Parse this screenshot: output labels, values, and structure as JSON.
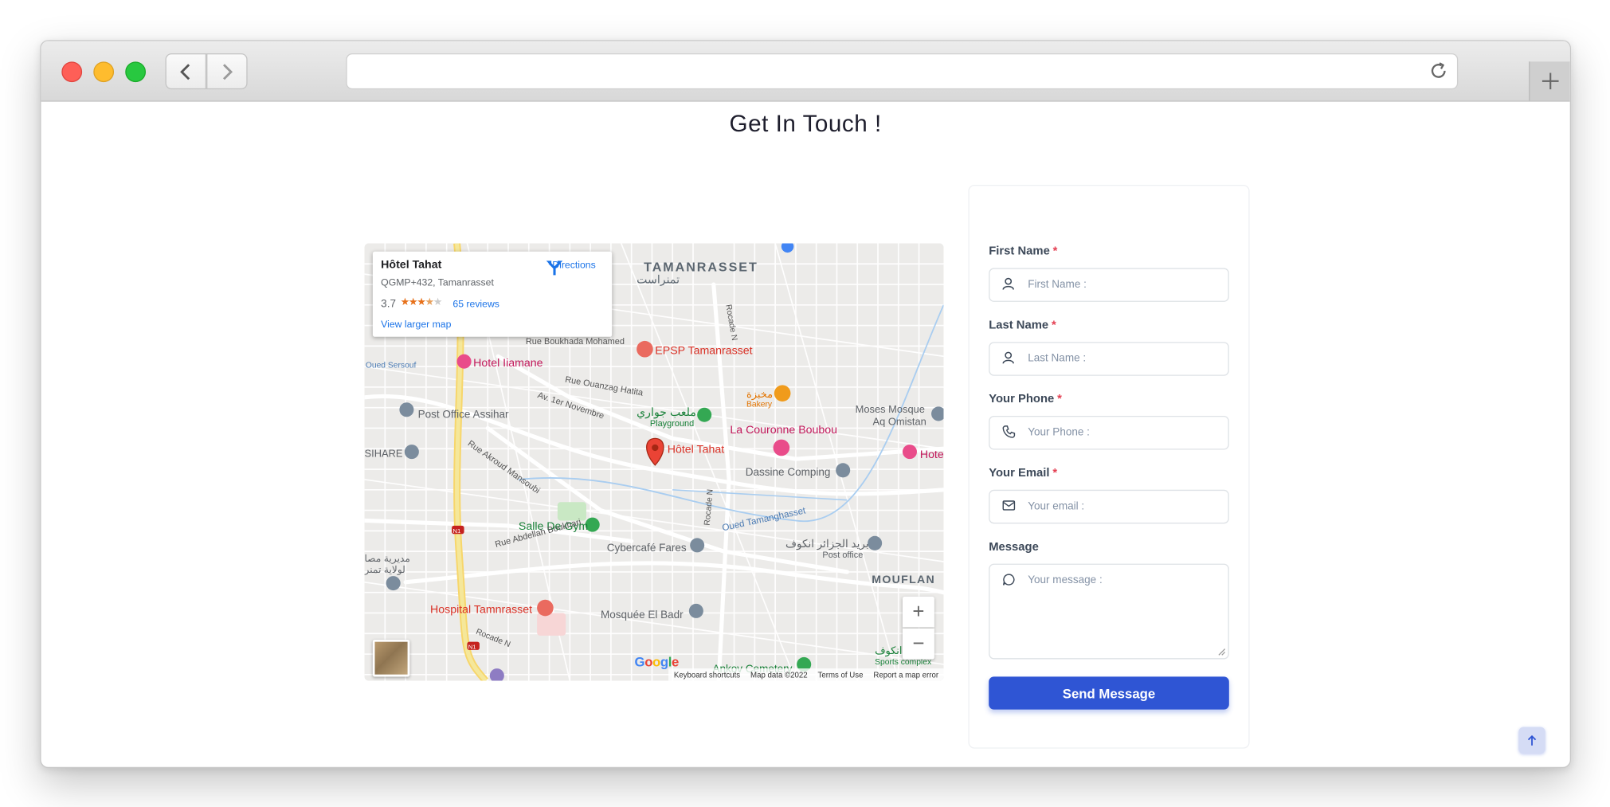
{
  "browser": {
    "back_icon": "chevron-left-icon",
    "forward_icon": "chevron-right-icon",
    "reload_icon": "reload-icon",
    "new_tab_icon": "plus-icon",
    "traffic_lights": {
      "close": "#fe5f57",
      "minimize": "#febc2e",
      "zoom": "#28c840"
    }
  },
  "page": {
    "title": "Get In Touch !"
  },
  "map": {
    "place_card": {
      "name": "Hôtel Tahat",
      "address": "QGMP+432, Tamanrasset",
      "rating": "3.7",
      "stars": 3.7,
      "reviews": "65 reviews",
      "view_larger": "View larger map",
      "directions": "Directions"
    },
    "labels": {
      "city": "TAMANRASSET",
      "city_ar": "تمنراست",
      "epsp": "EPSP Tamanrasset",
      "hotel_iiamane": "Hotel Iiamane",
      "rue_boukhada": "Rue Boukhada Mohamed",
      "oued_sersouf": "Oued Sersouf",
      "rue_ouanzag": "Rue Ouanzag Hatita",
      "av_novembre": "Av. 1er Novembre",
      "playground_ar": "ملعب جواري",
      "playground": "Playground",
      "bakery_ar": "مخبزة",
      "bakery": "Bakery",
      "couronne": "La Couronne Boubou",
      "moses_mosque": "Moses Mosque",
      "aq_omistan": "Aq Omistan",
      "post_office": "Post Office Assihar",
      "sihare": "SIHARE",
      "rue_akroud": "Rue Akroud Mansoubi",
      "hotel_tahat_pin": "Hôtel Tahat",
      "hotel_right": "Hote",
      "dassine": "Dassine Comping",
      "rocade_top": "Rocade N",
      "rocade_mid": "Rocade N",
      "oued_tam": "Oued Tamanghasset",
      "salle_gym": "Salle De Gym",
      "rue_abdellah": "Rue Abdellah Boukhari",
      "cybercafe": "Cybercafé Fares",
      "algerie_post_ar": "بريد الجزائر انكوف",
      "post_office_small": "Post office",
      "moufan": "MOUFLAN",
      "dir_ar": "مديرية مصا",
      "wilaya_ar": "لولاية تمنر",
      "hospital": "Hospital Tamnrasset",
      "mosquee": "Mosquée El Badr",
      "rocade_bottom": "Rocade N",
      "ankov_ar": "انكوف",
      "sports_complex": "Sports complex",
      "cemetery": "Ankov Cemetery",
      "n1_a": "N1",
      "n1_b": "N1"
    },
    "google_logo": "Google",
    "zoom_in": "+",
    "zoom_out": "−",
    "attribution": {
      "shortcuts": "Keyboard shortcuts",
      "mapdata": "Map data ©2022",
      "terms": "Terms of Use",
      "report": "Report a map error"
    }
  },
  "form": {
    "first_name": {
      "label": "First Name",
      "required": "*",
      "placeholder": "First Name :",
      "icon": "user-icon"
    },
    "last_name": {
      "label": "Last Name",
      "required": "*",
      "placeholder": "Last Name :",
      "icon": "user-icon"
    },
    "phone": {
      "label": "Your Phone",
      "required": "*",
      "placeholder": "Your Phone :",
      "icon": "phone-icon"
    },
    "email": {
      "label": "Your Email",
      "required": "*",
      "placeholder": "Your email :",
      "icon": "mail-icon"
    },
    "message": {
      "label": "Message",
      "placeholder": "Your message :",
      "icon": "message-circle-icon"
    },
    "submit": "Send Message"
  },
  "colors": {
    "primary": "#2f55d4",
    "required": "#e43f52",
    "map_red": "#ea4335",
    "map_pink": "#e94c8a",
    "map_green": "#34a853"
  },
  "back_to_top_icon": "arrow-up-icon"
}
